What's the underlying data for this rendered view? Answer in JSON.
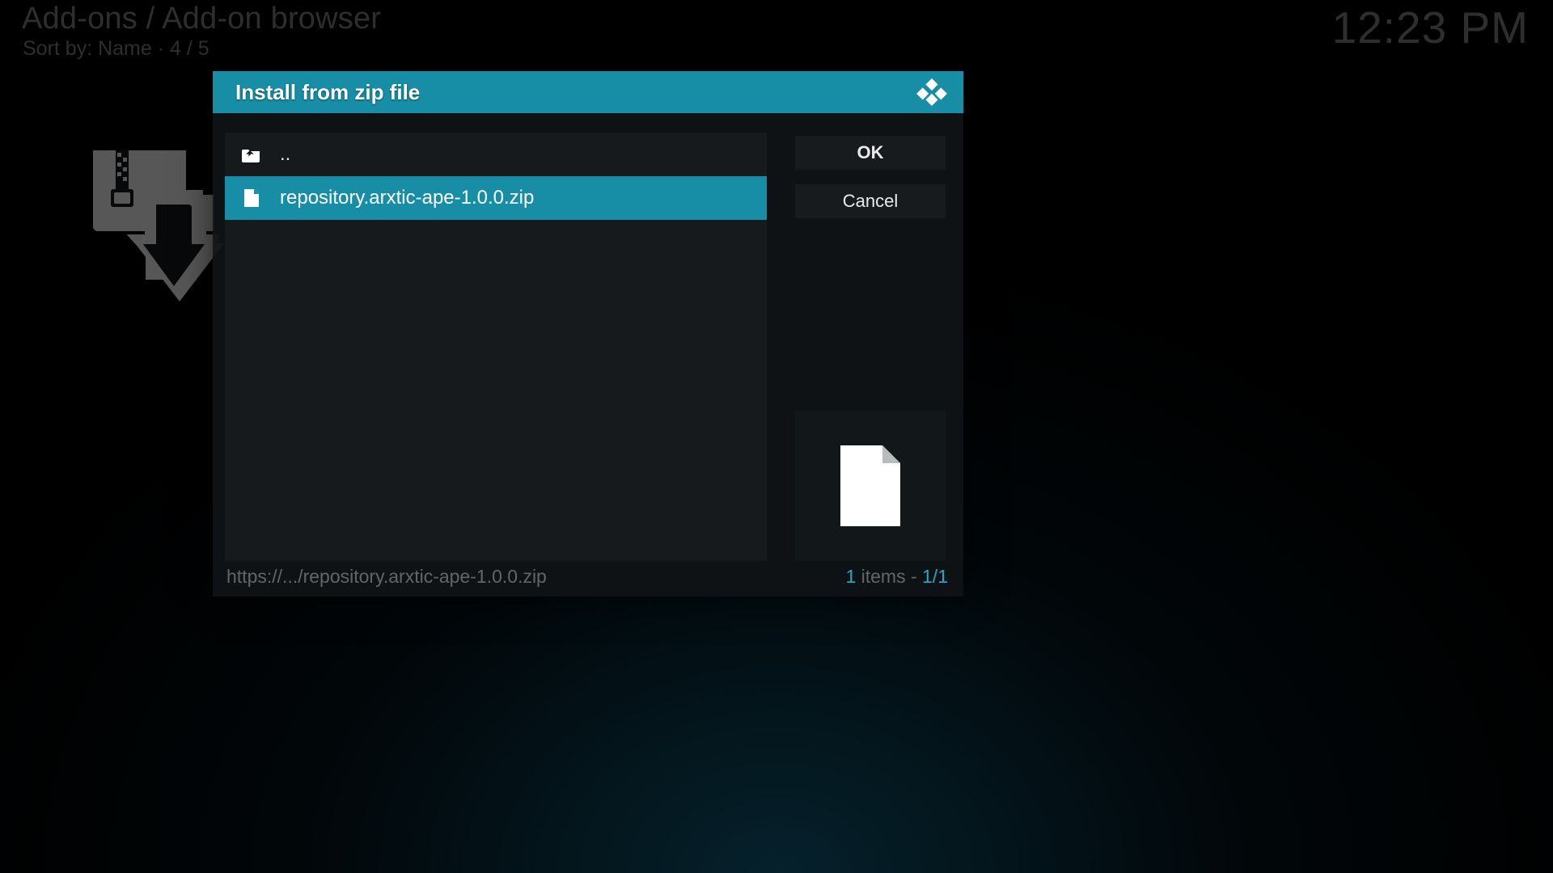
{
  "header": {
    "breadcrumb": "Add-ons / Add-on browser",
    "sort_prefix": "Sort by: ",
    "sort_value": "Name",
    "sort_sep": "  ·  ",
    "sort_pos": "4 / 5",
    "time": "12:23 PM"
  },
  "dialog": {
    "title": "Install from zip file",
    "rows": [
      {
        "icon": "folder-up-icon",
        "label": "..",
        "selected": false
      },
      {
        "icon": "file-icon",
        "label": "repository.arxtic-ape-1.0.0.zip",
        "selected": true
      }
    ],
    "buttons": {
      "ok": "OK",
      "cancel": "Cancel"
    }
  },
  "footer": {
    "path": "https://.../repository.arxtic-ape-1.0.0.zip",
    "count_num": "1",
    "count_word": " items - ",
    "count_pos": "1/1"
  },
  "colors": {
    "accent": "#178ea5"
  }
}
